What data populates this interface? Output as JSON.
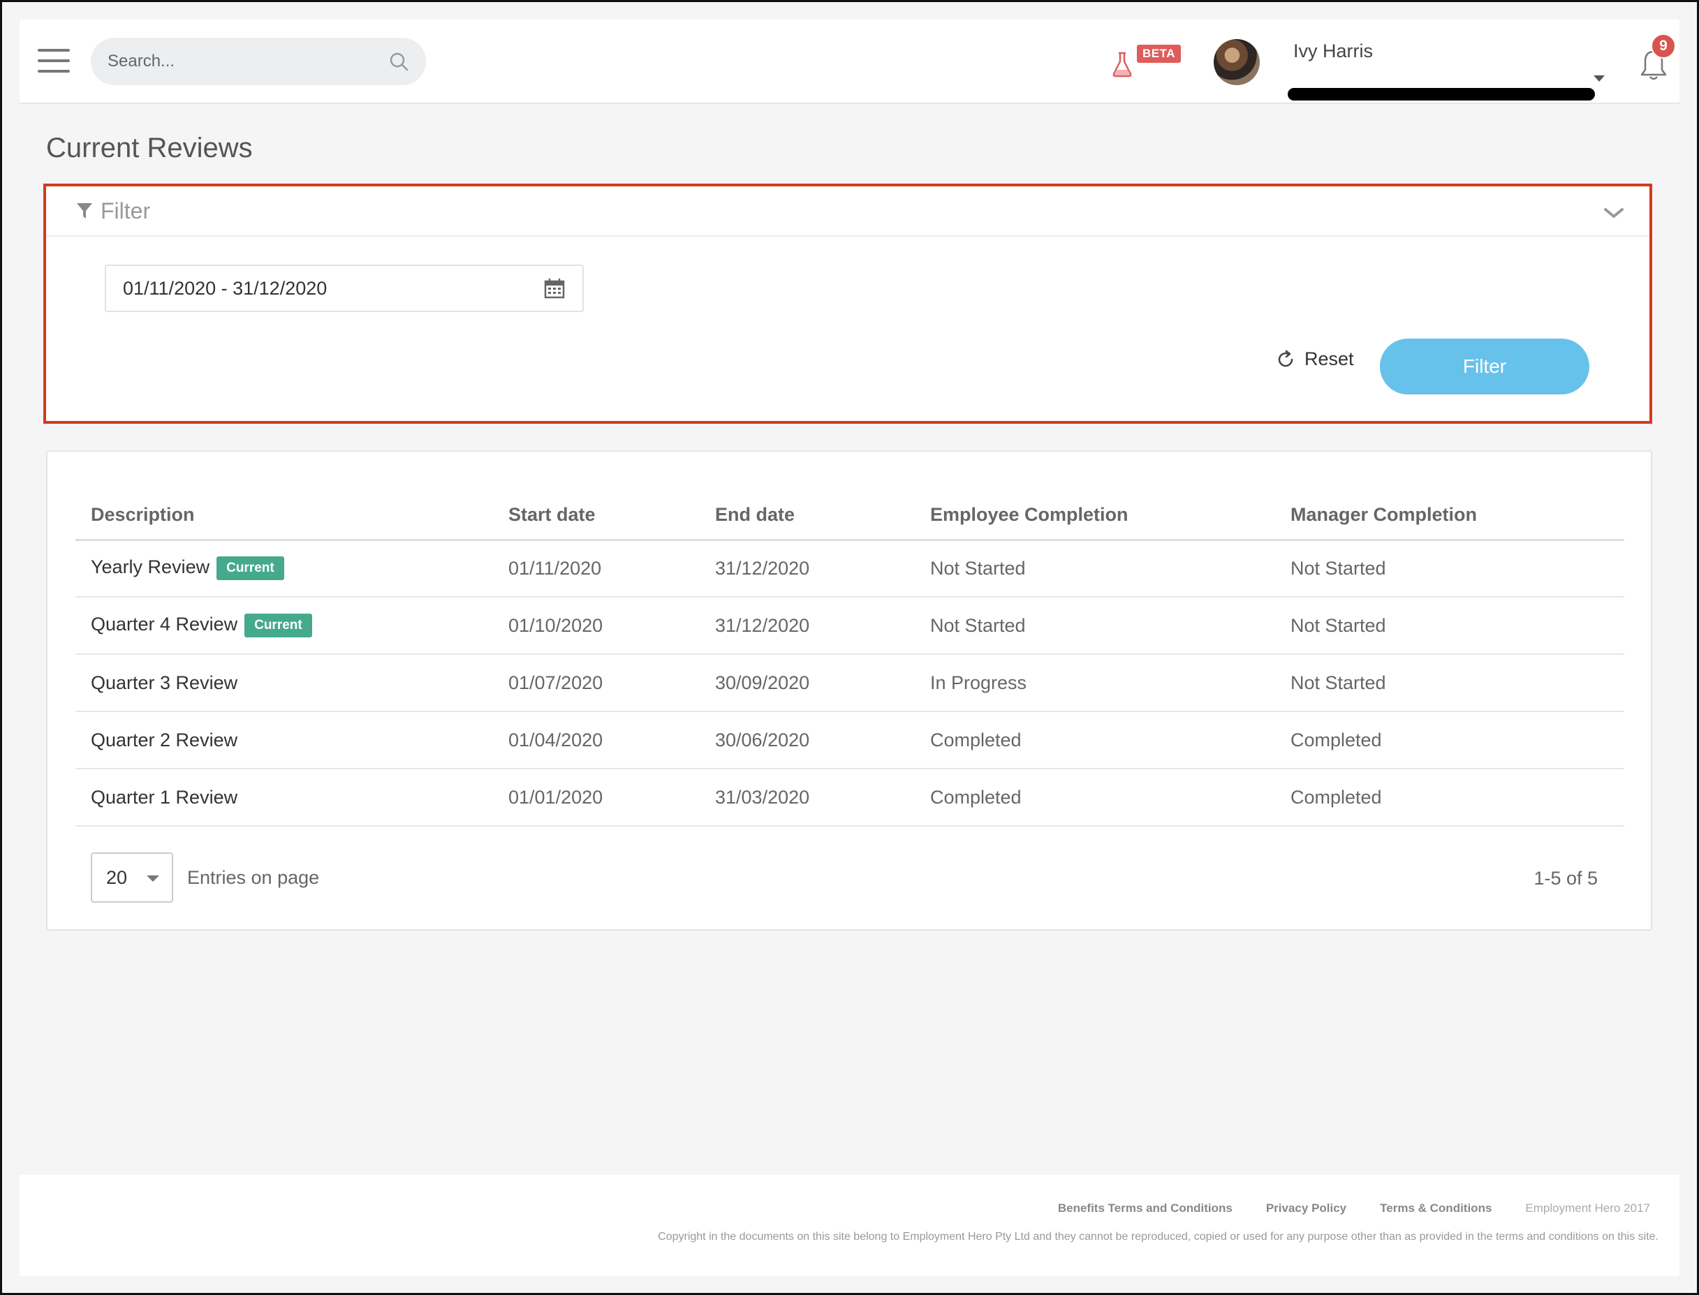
{
  "header": {
    "search_placeholder": "Search...",
    "beta_label": "BETA",
    "user_name": "Ivy Harris",
    "notification_count": "9"
  },
  "page": {
    "title": "Current Reviews"
  },
  "filter": {
    "title": "Filter",
    "date_range": "01/11/2020 - 31/12/2020",
    "reset_label": "Reset",
    "filter_button_label": "Filter"
  },
  "table": {
    "columns": [
      "Description",
      "Start date",
      "End date",
      "Employee Completion",
      "Manager Completion"
    ],
    "rows": [
      {
        "description": "Yearly Review",
        "badge": "Current",
        "start": "01/11/2020",
        "end": "31/12/2020",
        "employee": "Not Started",
        "manager": "Not Started"
      },
      {
        "description": "Quarter 4 Review",
        "badge": "Current",
        "start": "01/10/2020",
        "end": "31/12/2020",
        "employee": "Not Started",
        "manager": "Not Started"
      },
      {
        "description": "Quarter 3 Review",
        "badge": "",
        "start": "01/07/2020",
        "end": "30/09/2020",
        "employee": "In Progress",
        "manager": "Not Started"
      },
      {
        "description": "Quarter 2 Review",
        "badge": "",
        "start": "01/04/2020",
        "end": "30/06/2020",
        "employee": "Completed",
        "manager": "Completed"
      },
      {
        "description": "Quarter 1 Review",
        "badge": "",
        "start": "01/01/2020",
        "end": "31/03/2020",
        "employee": "Completed",
        "manager": "Completed"
      }
    ]
  },
  "pagination": {
    "page_size": "20",
    "entries_label": "Entries on page",
    "range": "1-5 of 5"
  },
  "footer": {
    "links": [
      "Benefits Terms and Conditions",
      "Privacy Policy",
      "Terms & Conditions"
    ],
    "brand": "Employment Hero 2017",
    "copyright": "Copyright in the documents on this site belong to Employment Hero Pty Ltd and they cannot be reproduced, copied or used for any purpose other than as provided in the terms and conditions on this site."
  },
  "colors": {
    "accent": "#67c2eb",
    "badge_current": "#45a98c",
    "highlight_border": "#d33a1c",
    "notification": "#d9534f"
  }
}
